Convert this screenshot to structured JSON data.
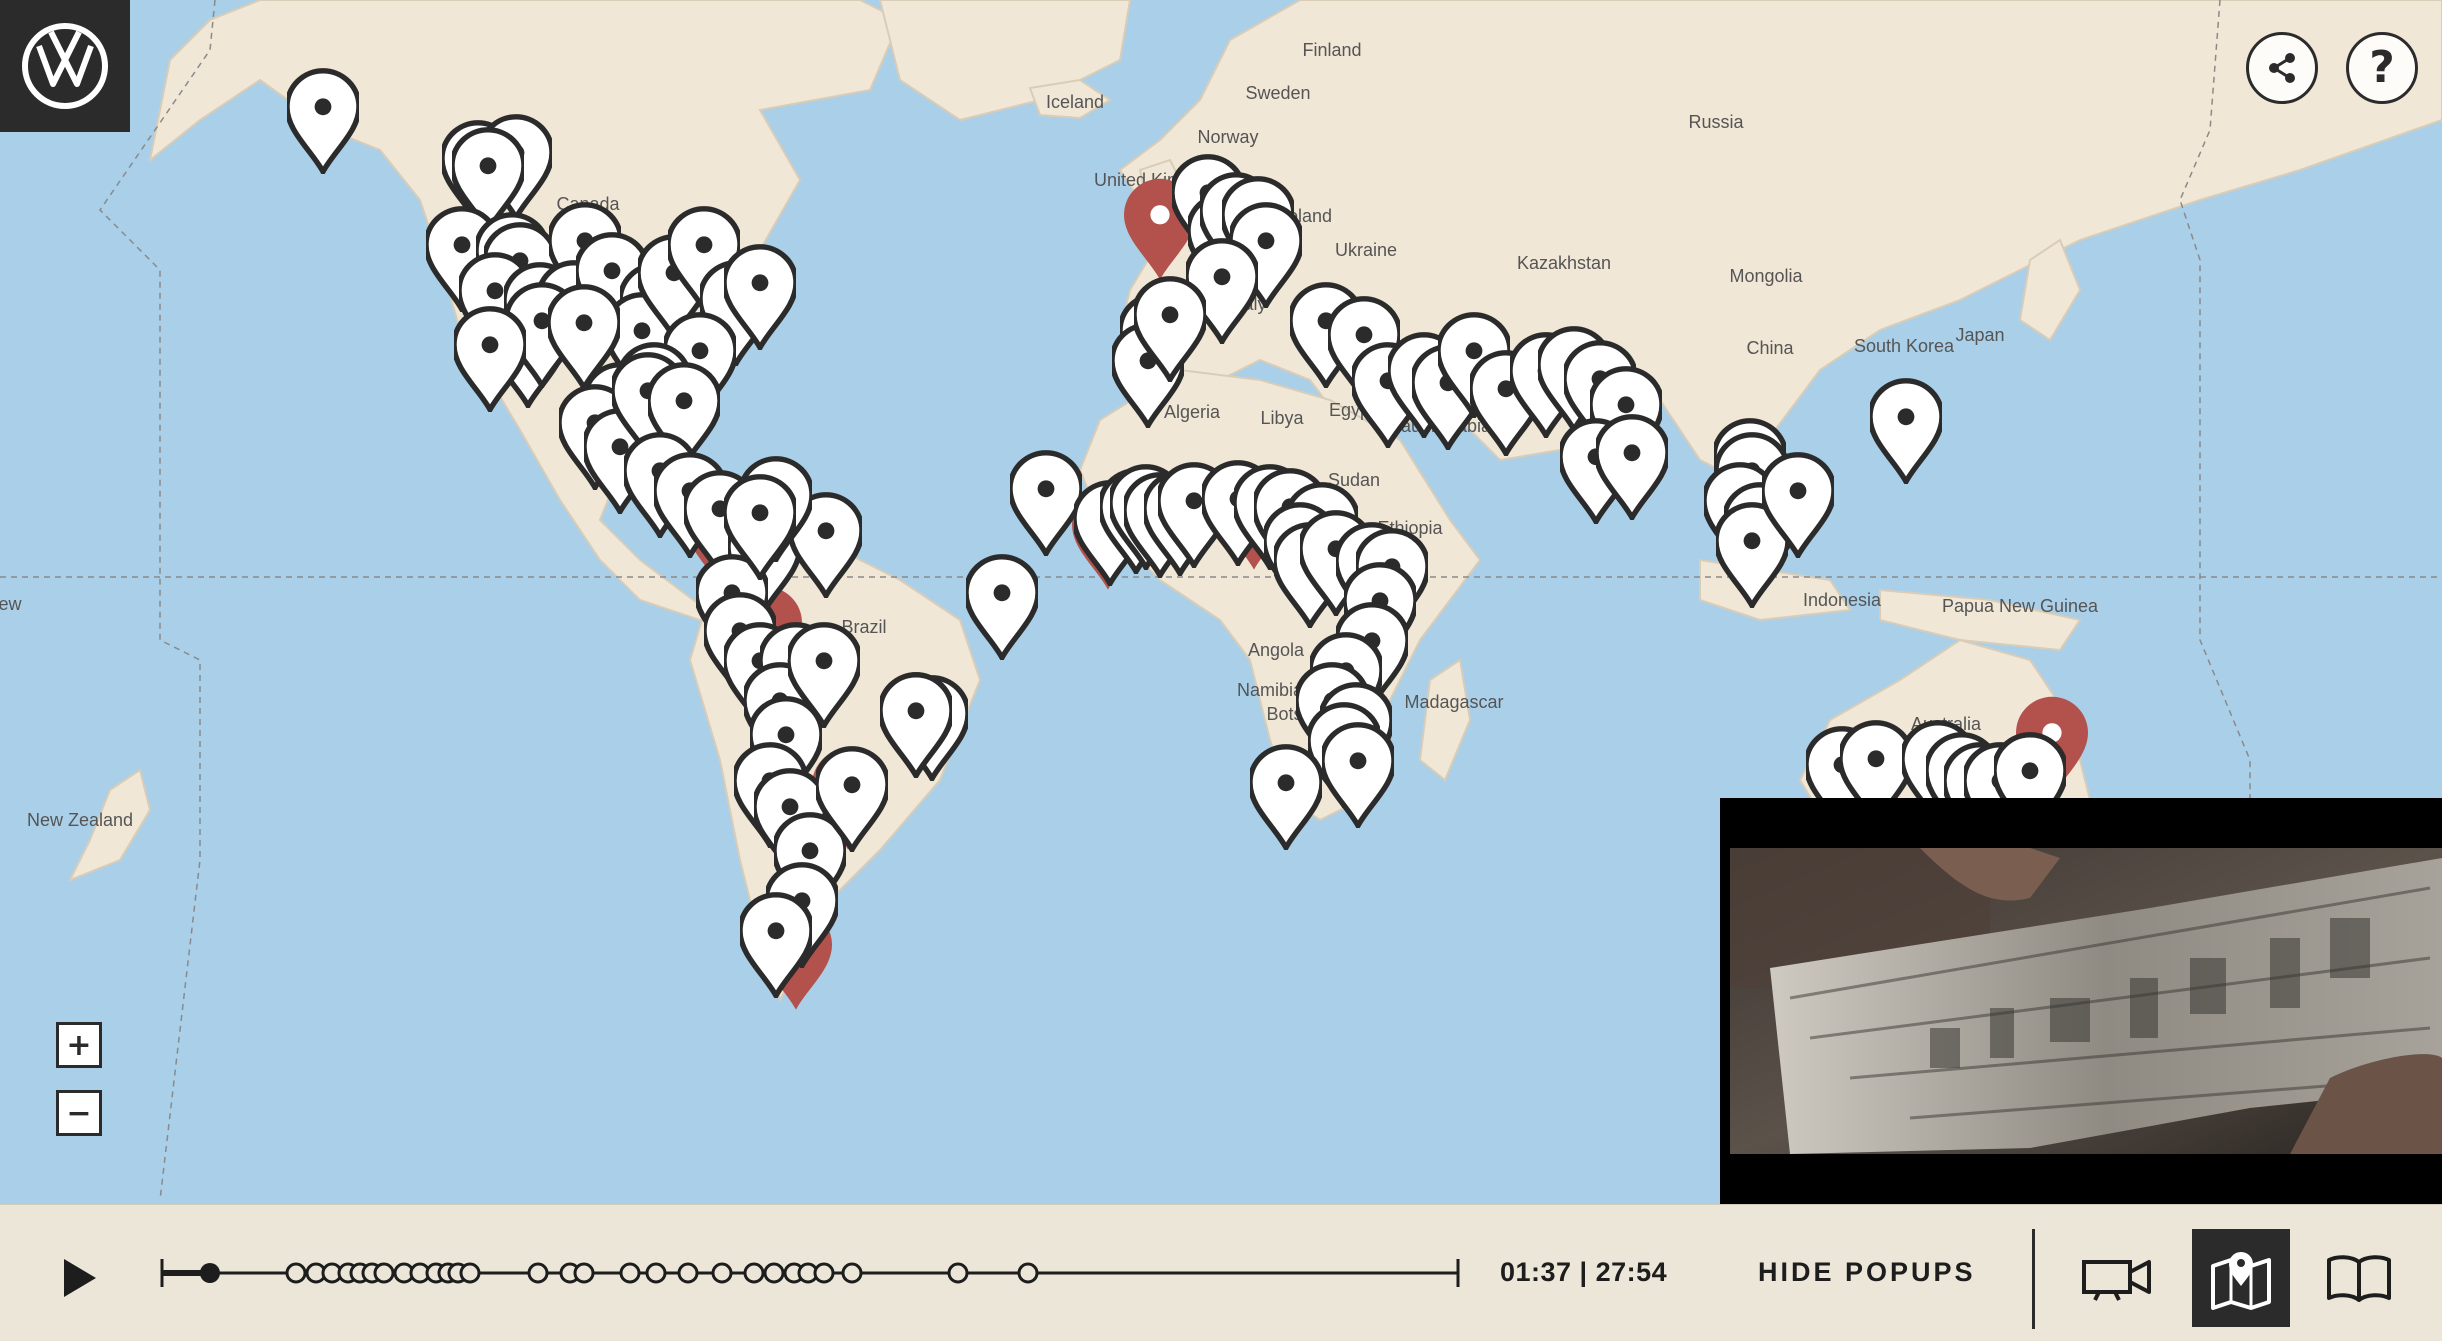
{
  "colors": {
    "ocean": "#a9cfe9",
    "land": "#f1e7d6",
    "pin_white": "#ffffff",
    "pin_red": "#b3514c",
    "pin_outline": "#2b2b2b",
    "bar_bg": "#ece6d9"
  },
  "header": {
    "logo_icon": "volkswagen-logo",
    "share_icon": "share-icon",
    "help_label": "?"
  },
  "map": {
    "labels": {
      "finland": "Finland",
      "sweden": "Sweden",
      "iceland": "Iceland",
      "norway": "Norway",
      "russia": "Russia",
      "uk": "United Kingdom",
      "poland": "Poland",
      "ukraine": "Ukraine",
      "kazakhstan": "Kazakhstan",
      "mongolia": "Mongolia",
      "italy": "Italy",
      "china": "China",
      "south_korea": "South Korea",
      "japan": "Japan",
      "algeria": "Algeria",
      "libya": "Libya",
      "egypt": "Egypt",
      "saudi": "Saudi Arabia",
      "sudan": "Sudan",
      "ethiopia": "Ethiopia",
      "brazil": "Brazil",
      "indonesia": "Indonesia",
      "png": "Papua New Guinea",
      "angola": "Angola",
      "namibia": "Namibia",
      "botswana": "Botswana",
      "madagascar": "Madagascar",
      "australia": "Australia",
      "canada": "Canada",
      "new_zealand": "New Zealand",
      "ew": "ew"
    }
  },
  "zoom": {
    "in_label": "+",
    "out_label": "−"
  },
  "controls": {
    "play_icon": "play-icon",
    "timecode": "01:37 | 27:54",
    "hide_popups_label": "HIDE POPUPS",
    "progress": 0.037,
    "modes": [
      {
        "name": "video-mode",
        "icon": "video-camera-icon",
        "active": false
      },
      {
        "name": "map-mode",
        "icon": "map-pin-icon",
        "active": true
      },
      {
        "name": "book-mode",
        "icon": "open-book-icon",
        "active": false
      }
    ]
  }
}
